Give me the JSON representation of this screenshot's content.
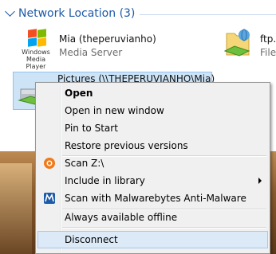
{
  "group": {
    "title": "Network Location (3)"
  },
  "items": {
    "mia": {
      "name": "Mia (theperuvianho)",
      "desc": "Media Server",
      "logo_text": "Windows Media Player"
    },
    "ftp": {
      "name": "ftp.m",
      "desc": "File"
    },
    "pictures": {
      "name": "Pictures (\\\\THEPERUVIANHO\\Mia)"
    }
  },
  "menu": {
    "open": "Open",
    "open_new_window": "Open in new window",
    "pin_to_start": "Pin to Start",
    "restore_previous": "Restore previous versions",
    "scan_z": "Scan Z:\\",
    "include_library": "Include in library",
    "scan_malwarebytes": "Scan with Malwarebytes Anti-Malware",
    "always_offline": "Always available offline",
    "disconnect": "Disconnect"
  },
  "colors": {
    "accent": "#1e5aa8",
    "highlight": "#dce9f7"
  },
  "icons": [
    "windows-media-player-icon",
    "ftp-folder-icon",
    "network-drive-icon",
    "avast-scan-icon",
    "malwarebytes-icon",
    "submenu-arrow-icon"
  ]
}
